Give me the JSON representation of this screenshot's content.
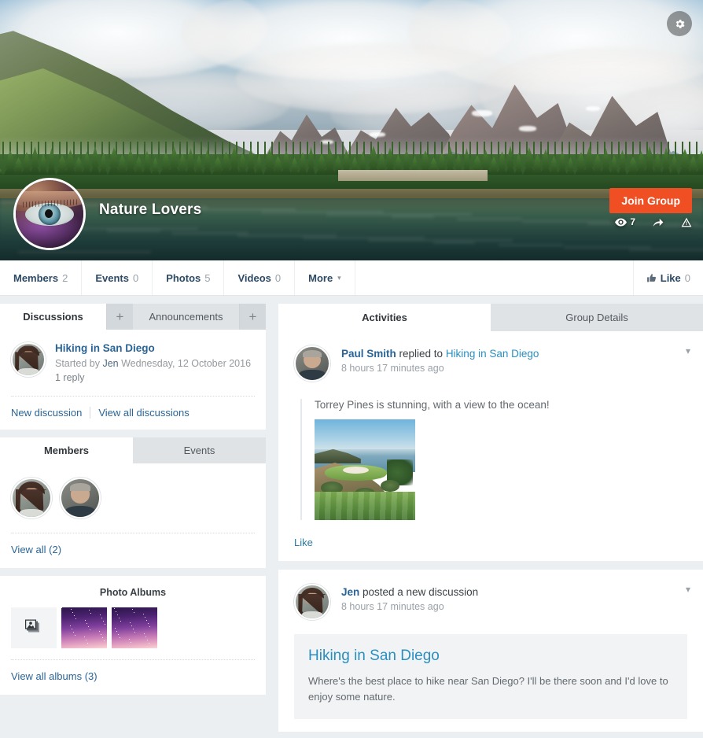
{
  "hero": {
    "settings_icon": "gear-icon",
    "group_name": "Nature Lovers",
    "join_label": "Join Group",
    "views_icon": "eye-icon",
    "views_count": "7",
    "share_icon": "share-arrow-icon",
    "report_icon": "warning-triangle-icon",
    "accent_color": "#f04e23"
  },
  "nav": {
    "items": [
      {
        "label": "Members",
        "count": "2"
      },
      {
        "label": "Events",
        "count": "0"
      },
      {
        "label": "Photos",
        "count": "5"
      },
      {
        "label": "Videos",
        "count": "0"
      },
      {
        "label": "More",
        "count": ""
      }
    ],
    "more_caret": "chevron-down-icon",
    "like_icon": "thumbs-up-icon",
    "like_label": "Like",
    "like_count": "0"
  },
  "sidebar": {
    "discussions_panel": {
      "tabs": [
        {
          "label": "Discussions",
          "active": true
        },
        {
          "label": "Announcements",
          "active": false
        }
      ],
      "add_label": "+",
      "items": [
        {
          "title": "Hiking in San Diego",
          "started_prefix": "Started by",
          "author": "Jen",
          "date": "Wednesday, 12 October 2016",
          "replies": "1 reply",
          "avatar": "avatar-jen"
        }
      ],
      "new_discussion_label": "New discussion",
      "view_all_label": "View all discussions"
    },
    "members_panel": {
      "tabs": [
        {
          "label": "Members",
          "active": true
        },
        {
          "label": "Events",
          "active": false
        }
      ],
      "avatars": [
        "avatar-jen",
        "avatar-paul"
      ],
      "view_all_label": "View all (2)"
    },
    "albums_panel": {
      "title": "Photo Albums",
      "thumbs": [
        "album-placeholder",
        "album-galaxy",
        "album-galaxy"
      ],
      "view_all_label": "View all albums (3)"
    }
  },
  "main": {
    "tabs": [
      {
        "label": "Activities",
        "active": true
      },
      {
        "label": "Group Details",
        "active": false
      }
    ],
    "posts": [
      {
        "author": "Paul Smith",
        "action": " replied to ",
        "target": "Hiking in San Diego",
        "time": "8 hours 17 minutes ago",
        "avatar": "avatar-paul",
        "caret": "chevron-down-icon",
        "quote_text": "Torrey Pines is stunning, with a view to the ocean!",
        "quote_image": "torrey-pines-golf-course",
        "like_label": "Like"
      },
      {
        "author": "Jen",
        "action": " posted a new discussion",
        "target": "",
        "time": "8 hours 17 minutes ago",
        "avatar": "avatar-jen",
        "caret": "chevron-down-icon",
        "discussion_title": "Hiking in San Diego",
        "discussion_body": "Where's the best place to hike near San Diego? I'll be there soon and I'd love to enjoy some nature."
      }
    ]
  }
}
